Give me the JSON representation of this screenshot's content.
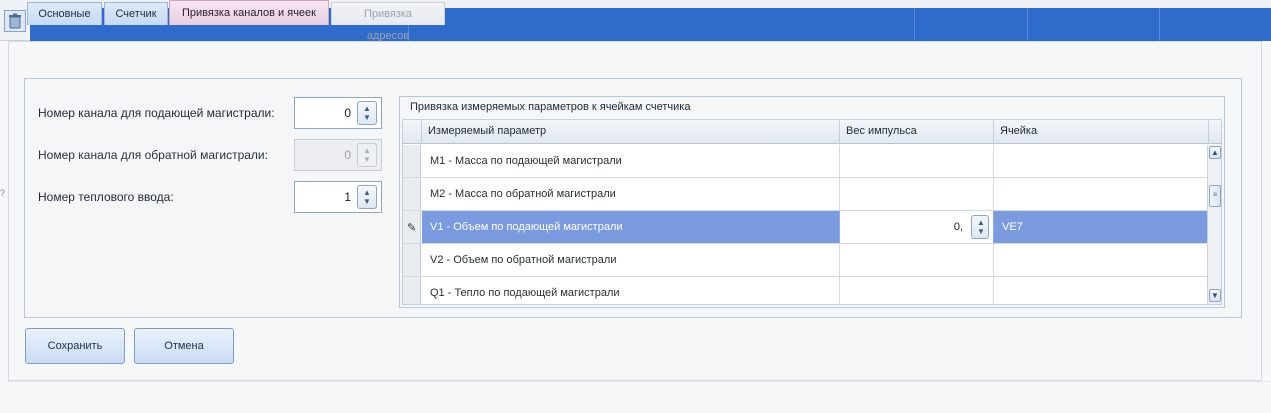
{
  "tabs": [
    {
      "label": "Основные",
      "state": "normal"
    },
    {
      "label": "Счетчик",
      "state": "normal"
    },
    {
      "label": "Привязка каналов и ячеек",
      "state": "active"
    },
    {
      "label": "Привязка адресов",
      "state": "disabled"
    }
  ],
  "form": {
    "supply_channel": {
      "label": "Номер канала для подающей магистрали:",
      "value": "0"
    },
    "return_channel": {
      "label": "Номер канала для обратной магистрали:",
      "value": "0"
    },
    "heat_input": {
      "label": "Номер теплового ввода:",
      "value": "1"
    }
  },
  "binding": {
    "title": "Привязка измеряемых параметров к ячейкам счетчика",
    "columns": [
      "Измеряемый параметр",
      "Вес импульса",
      "Ячейка"
    ],
    "rows": [
      {
        "param": "M1 - Масса по подающей магистрали",
        "weight": "",
        "cell": ""
      },
      {
        "param": "M2 - Масса по обратной магистрали",
        "weight": "",
        "cell": ""
      },
      {
        "param": "V1 - Объем по подающей магистрали",
        "weight": "0,",
        "cell": "VE7",
        "selected": true
      },
      {
        "param": "V2 - Объем по обратной магистрали",
        "weight": "",
        "cell": ""
      },
      {
        "param": "Q1 - Тепло по подающей магистрали",
        "weight": "",
        "cell": ""
      }
    ]
  },
  "buttons": {
    "save": "Сохранить",
    "cancel": "Отмена"
  },
  "colors": {
    "header_band": "#2f6bca",
    "selected_row": "#7b9be0",
    "active_tab": "#e6cfe0"
  },
  "icons": {
    "trash": "trash-icon",
    "edit": "pencil-icon"
  }
}
